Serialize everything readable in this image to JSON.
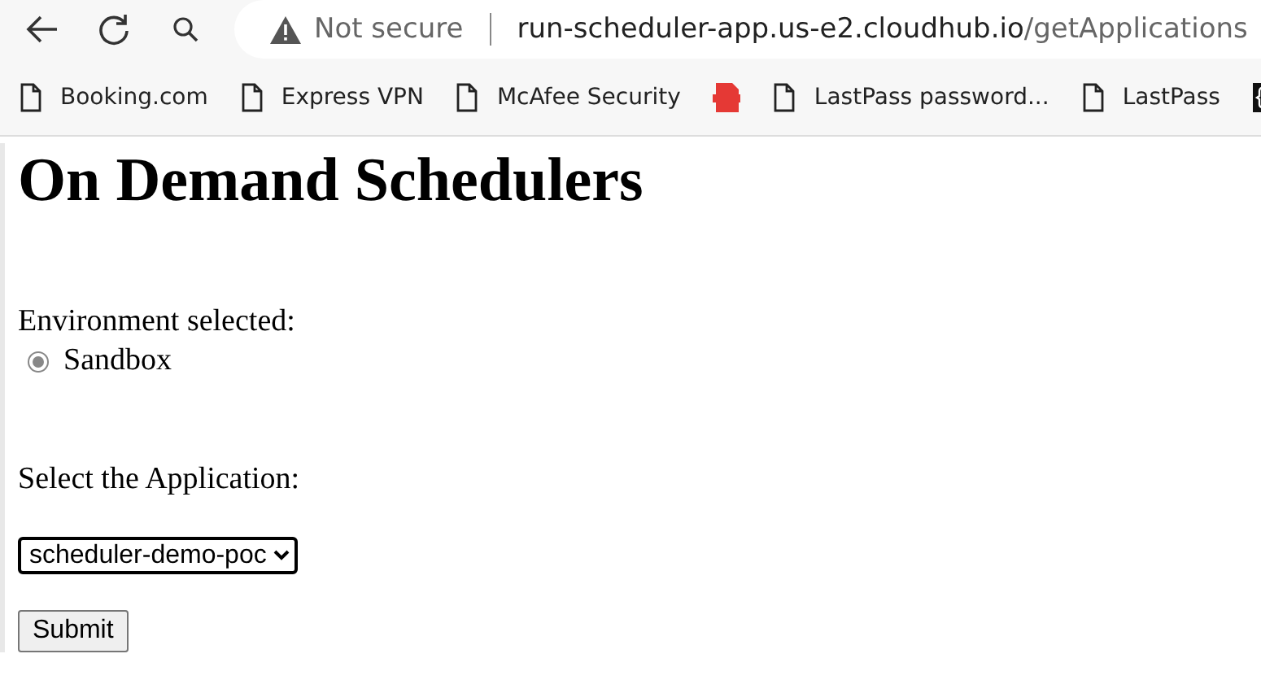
{
  "address_bar": {
    "security": "Not secure",
    "url_host": "run-scheduler-app.us-e2.cloudhub.io",
    "url_path": "/getApplications"
  },
  "bookmarks": [
    {
      "kind": "page",
      "label": "Booking.com"
    },
    {
      "kind": "page",
      "label": "Express VPN"
    },
    {
      "kind": "page",
      "label": "McAfee Security"
    },
    {
      "kind": "pdf"
    },
    {
      "kind": "page",
      "label": "LastPass password..."
    },
    {
      "kind": "page",
      "label": "LastPass"
    },
    {
      "kind": "code"
    }
  ],
  "page": {
    "heading": "On Demand Schedulers",
    "environment_label": "Environment selected:",
    "environments": [
      {
        "label": "Sandbox",
        "selected": true,
        "disabled": true
      }
    ],
    "application_label": "Select the Application:",
    "application_select": {
      "value": "scheduler-demo-poc"
    },
    "submit_button": "Submit"
  }
}
